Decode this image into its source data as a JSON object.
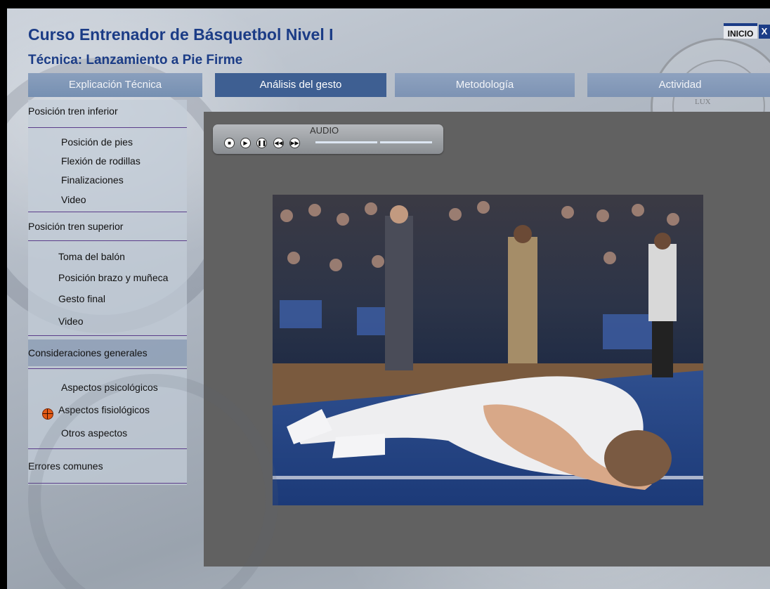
{
  "header": {
    "title": "Curso Entrenador de Básquetbol Nivel I",
    "subtitle": "Técnica: Lanzamiento a Pie Firme"
  },
  "topbar": {
    "inicio_label": "INICIO",
    "close_label": "X"
  },
  "tabs": [
    {
      "label": "Explicación Técnica"
    },
    {
      "label": "Análisis del gesto"
    },
    {
      "label": "Metodología"
    },
    {
      "label": "Actividad"
    }
  ],
  "sidebar": {
    "sections": [
      {
        "label": "Posición tren inferior",
        "items": [
          "Posición de pies",
          "Flexión de rodillas",
          "Finalizaciones",
          "Video"
        ]
      },
      {
        "label": "Posición tren superior",
        "items": [
          "Toma del balón",
          "Posición brazo y muñeca",
          "Gesto final",
          "Video"
        ]
      },
      {
        "label": "Consideraciones generales",
        "items": [
          "Aspectos psicológicos",
          "Aspectos fisiológicos",
          "Otros aspectos"
        ]
      },
      {
        "label": "Errores comunes",
        "items": []
      }
    ],
    "active_section": "Consideraciones generales",
    "current_item": "Aspectos fisiológicos"
  },
  "audio": {
    "label": "AUDIO"
  },
  "seal": {
    "text": "LUX"
  },
  "colors": {
    "title": "#1b3c86",
    "active_tab": "#3e5f92",
    "panel": "#616161",
    "separator": "#5b3d8a"
  },
  "icons": [
    "basketball-icon",
    "stop-icon",
    "play-icon",
    "pause-icon",
    "rewind-icon",
    "forward-icon"
  ]
}
